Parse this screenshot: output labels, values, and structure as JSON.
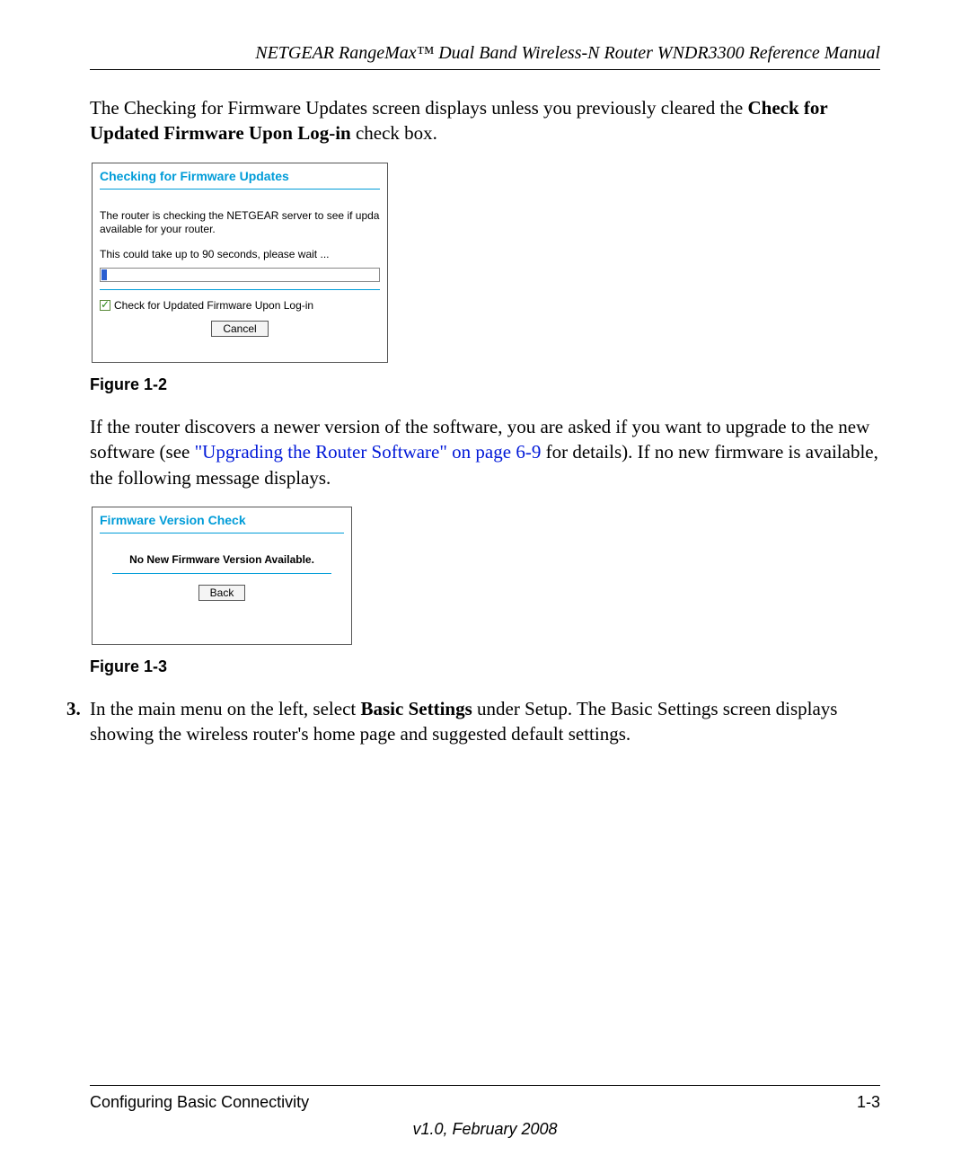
{
  "header": {
    "title": "NETGEAR RangeMax™ Dual Band Wireless-N Router WNDR3300 Reference Manual"
  },
  "para1_a": "The Checking for Firmware Updates screen displays unless you previously cleared the ",
  "para1_b": "Check for Updated Firmware Upon Log-in",
  "para1_c": " check box.",
  "dialog1": {
    "title": "Checking for Firmware Updates",
    "text": "The router is checking the NETGEAR server to see if upda available for your router.",
    "wait": "This could take up to 90 seconds, please wait ...",
    "checkbox_label": "Check for Updated Firmware Upon Log-in",
    "cancel": "Cancel"
  },
  "caption1": "Figure 1-2",
  "para2_a": "If the router discovers a newer version of the software, you are asked if you want to upgrade to the new software (see ",
  "para2_link": "\"Upgrading the Router Software\" on page 6-9",
  "para2_b": " for details). If no new firmware is available, the following message displays.",
  "dialog2": {
    "title": "Firmware Version Check",
    "msg": "No New Firmware Version Available.",
    "back": "Back"
  },
  "caption2": "Figure 1-3",
  "step3": {
    "num": "3.",
    "text_a": "In the main menu on the left, select ",
    "text_b": "Basic Settings",
    "text_c": " under Setup. The Basic Settings screen displays showing the wireless router's home page and suggested default settings."
  },
  "footer": {
    "section": "Configuring Basic Connectivity",
    "pagenum": "1-3",
    "version": "v1.0, February 2008"
  }
}
